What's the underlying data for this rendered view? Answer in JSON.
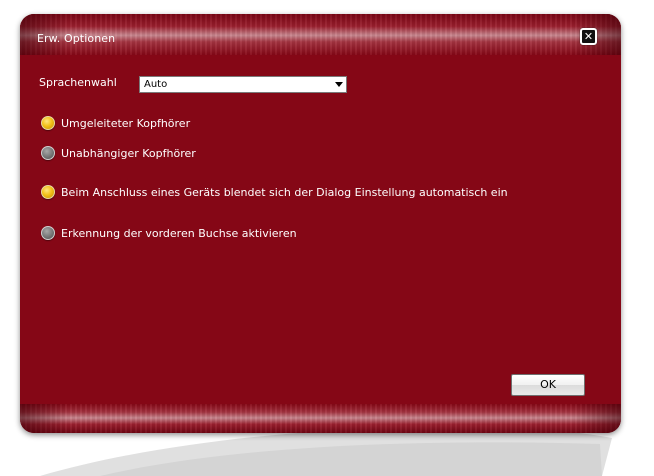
{
  "window": {
    "title": "Erw. Optionen",
    "close_icon": "close-icon",
    "accent_color": "#850716"
  },
  "language": {
    "label": "Sprachenwahl",
    "selected": "Auto"
  },
  "options": [
    {
      "label": "Umgeleiteter Kopfhörer",
      "checked": true
    },
    {
      "label": "Unabhängiger Kopfhörer",
      "checked": false
    },
    {
      "label": "Beim Anschluss eines Geräts blendet sich der Dialog Einstellung automatisch ein",
      "checked": true
    },
    {
      "label": "Erkennung der vorderen Buchse aktivieren",
      "checked": false
    }
  ],
  "buttons": {
    "ok_label": "OK"
  }
}
